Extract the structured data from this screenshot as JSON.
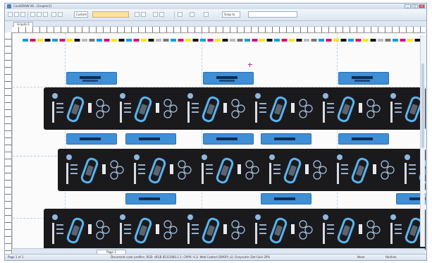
{
  "window": {
    "title": "CorelDRAW X6 - [Graphic1]",
    "controls": [
      "_",
      "□",
      "×"
    ]
  },
  "toolbar": {
    "zoom_value": "Custom",
    "font_value": "",
    "snap_label": "Snap to"
  },
  "document": {
    "tab_label": "Graphic1",
    "page_label": "Page 1"
  },
  "status": {
    "left_text": "Page 1 of 1",
    "mid_text": "Document color profiles: RGB: sRGB IEC61966-2.1; CMYK: U.S. Web Coated (SWOP) v2; Grayscale: Dot Gain 20%",
    "fill_label": "None",
    "outline_label": "Hairline"
  },
  "colors": {
    "frame": "#dde6f0",
    "accent": "#3f8fd6",
    "dieline_dark": "#1a1a1d",
    "registration": "#c0348a"
  },
  "icons": {
    "app": "corel-icon",
    "new": "new-document-icon",
    "open": "open-icon",
    "save": "save-icon",
    "undo": "undo-icon",
    "redo": "redo-icon",
    "import": "import-icon",
    "export": "export-icon",
    "zoom": "zoom-icon"
  }
}
